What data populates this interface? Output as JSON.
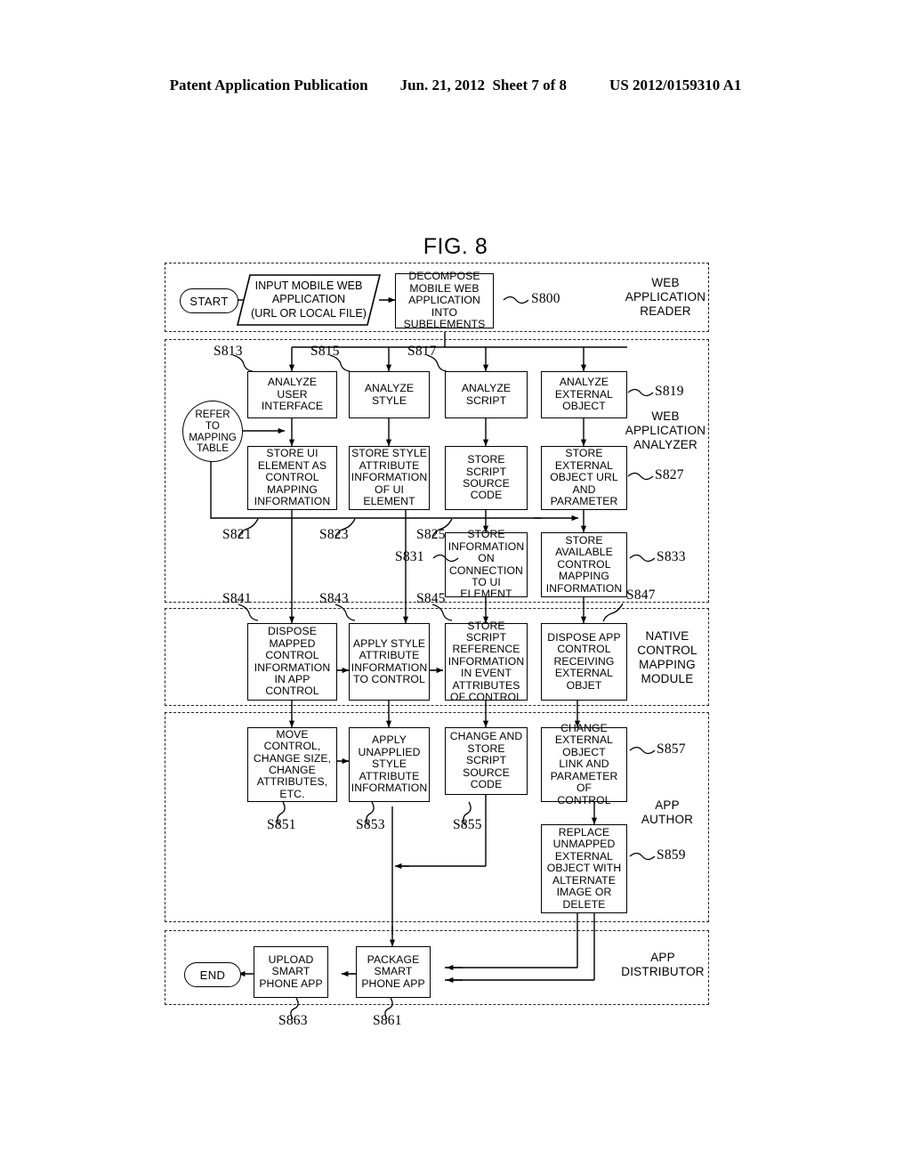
{
  "header": {
    "left": "Patent Application Publication",
    "middle": "Jun. 21, 2012  Sheet 7 of 8",
    "right": "US 2012/0159310 A1"
  },
  "figure": {
    "title": "FIG. 8",
    "bands": [
      {
        "id": "web-application-reader",
        "label": "WEB\nAPPLICATION\nREADER"
      },
      {
        "id": "web-application-analyzer",
        "label": "WEB\nAPPLICATION\nANALYZER"
      },
      {
        "id": "native-control-mapping-module",
        "label": "NATIVE\nCONTROL\nMAPPING\nMODULE"
      },
      {
        "id": "app-author",
        "label": "APP\nAUTHOR"
      },
      {
        "id": "app-distributor",
        "label": "APP\nDISTRIBUTOR"
      }
    ],
    "terminators": {
      "start": "START",
      "end": "END"
    },
    "connector_circle": "REFER\nTO\nMAPPING\nTABLE",
    "nodes": [
      {
        "id": "input-mobile-web-application",
        "text": "INPUT MOBILE WEB\nAPPLICATION\n(URL OR LOCAL FILE)",
        "ref": ""
      },
      {
        "id": "decompose-mobile-web-application",
        "text": "DECOMPOSE\nMOBILE WEB\nAPPLICATION INTO\nSUBELEMENTS",
        "ref": "S800"
      },
      {
        "id": "analyze-user-interface",
        "text": "ANALYZE\nUSER INTERFACE",
        "ref": "S813"
      },
      {
        "id": "analyze-style",
        "text": "ANALYZE STYLE",
        "ref": "S815"
      },
      {
        "id": "analyze-script",
        "text": "ANALYZE\nSCRIPT",
        "ref": "S817"
      },
      {
        "id": "analyze-external-object",
        "text": "ANALYZE\nEXTERNAL\nOBJECT",
        "ref": "S819"
      },
      {
        "id": "store-ui-element-as-control-mapping-information",
        "text": "STORE UI\nELEMENT AS\nCONTROL\nMAPPING\nINFORMATION",
        "ref": "S821"
      },
      {
        "id": "store-style-attribute-information-of-ui-element",
        "text": "STORE STYLE\nATTRIBUTE\nINFORMATION\nOF UI ELEMENT",
        "ref": "S823"
      },
      {
        "id": "store-script-source-code",
        "text": "STORE SCRIPT\nSOURCE CODE",
        "ref": "S825"
      },
      {
        "id": "store-external-object-url-and-parameter",
        "text": "STORE\nEXTERNAL\nOBJECT URL\nAND\nPARAMETER",
        "ref": "S827"
      },
      {
        "id": "store-information-on-connection-to-ui-element",
        "text": "STORE\nINFORMATION\nON\nCONNECTION\nTO UI ELEMENT",
        "ref": "S831"
      },
      {
        "id": "store-available-control-mapping-information",
        "text": "STORE\nAVAILABLE\nCONTROL\nMAPPING\nINFORMATION",
        "ref": "S833"
      },
      {
        "id": "dispose-mapped-control-information-in-app-control",
        "text": "DISPOSE\nMAPPED\nCONTROL\nINFORMATION\nIN APP\nCONTROL",
        "ref": "S841"
      },
      {
        "id": "apply-style-attribute-information-to-control",
        "text": "APPLY STYLE\nATTRIBUTE\nINFORMATION\nTO CONTROL",
        "ref": "S843"
      },
      {
        "id": "store-script-reference-information-in-event-attributes-of-control",
        "text": "STORE SCRIPT\nREFERENCE\nINFORMATION\nIN EVENT\nATTRIBUTES\nOF CONTROL",
        "ref": "S845"
      },
      {
        "id": "dispose-app-control-receiving-external-objet",
        "text": "DISPOSE APP\nCONTROL\nRECEIVING\nEXTERNAL\nOBJET",
        "ref": "S847"
      },
      {
        "id": "move-control-change-size-change-attributes-etc",
        "text": "MOVE\nCONTROL,\nCHANGE SIZE,\nCHANGE\nATTRIBUTES,\nETC.",
        "ref": "S851"
      },
      {
        "id": "apply-unapplied-style-attribute-information",
        "text": "APPLY\nUNAPPLIED\nSTYLE\nATTRIBUTE\nINFORMATION",
        "ref": "S853"
      },
      {
        "id": "change-and-store-script-source-code",
        "text": "CHANGE AND\nSTORE SCRIPT\nSOURCE CODE",
        "ref": "S855"
      },
      {
        "id": "change-external-object-link-and-parameter-of-control",
        "text": "CHANGE\nEXTERNAL\nOBJECT\nLINK AND\nPARAMETER OF\nCONTROL",
        "ref": "S857"
      },
      {
        "id": "replace-unmapped-external-object-with-alternate-image-or-delete",
        "text": "REPLACE\nUNMAPPED\nEXTERNAL\nOBJECT WITH\nALTERNATE\nIMAGE OR\nDELETE",
        "ref": "S859"
      },
      {
        "id": "package-smart-phone-app",
        "text": "PACKAGE\nSMART\nPHONE APP",
        "ref": "S861"
      },
      {
        "id": "upload-smart-phone-app",
        "text": "UPLOAD\nSMART\nPHONE APP",
        "ref": "S863"
      }
    ]
  }
}
